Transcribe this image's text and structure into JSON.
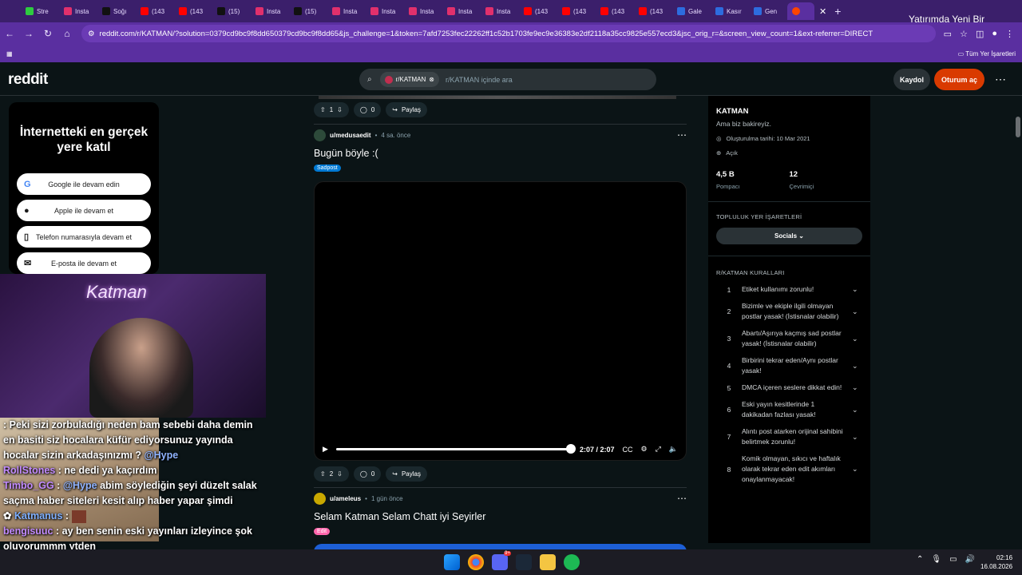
{
  "browser": {
    "tabs": [
      {
        "label": "Stre",
        "color": "#2ecc40"
      },
      {
        "label": "Insta",
        "color": "#e1306c"
      },
      {
        "label": "Soğı",
        "color": "#111111"
      },
      {
        "label": "(143",
        "color": "#ff0000"
      },
      {
        "label": "(143",
        "color": "#ff0000"
      },
      {
        "label": "(15)",
        "color": "#111111"
      },
      {
        "label": "Insta",
        "color": "#e1306c"
      },
      {
        "label": "(15)",
        "color": "#111111"
      },
      {
        "label": "Insta",
        "color": "#e1306c"
      },
      {
        "label": "Insta",
        "color": "#e1306c"
      },
      {
        "label": "Insta",
        "color": "#e1306c"
      },
      {
        "label": "Insta",
        "color": "#e1306c"
      },
      {
        "label": "Insta",
        "color": "#e1306c"
      },
      {
        "label": "(143",
        "color": "#ff0000"
      },
      {
        "label": "(143",
        "color": "#ff0000"
      },
      {
        "label": "(143",
        "color": "#ff0000"
      },
      {
        "label": "(143",
        "color": "#ff0000"
      },
      {
        "label": "Gale",
        "color": "#2d6cdf"
      },
      {
        "label": "Kasır",
        "color": "#2d6cdf"
      },
      {
        "label": "Gen",
        "color": "#2d6cdf"
      }
    ],
    "active_tab_icon": "reddit-icon",
    "url": "reddit.com/r/KATMAN/?solution=0379cd9bc9f8dd650379cd9bc9f8dd65&js_challenge=1&token=7afd7253fec22262ff1c52b1703fe9ec9e36383e2df2118a35cc9825e557ecd3&jsc_orig_r=&screen_view_count=1&ext-referrer=DIRECT",
    "bookmarks_label": "Tüm Yer İşaretleri",
    "popup_text": "Yatırımda Yeni Bir Alternatif"
  },
  "header": {
    "logo": "reddit",
    "search_chip": "r/KATMAN",
    "search_placeholder": "r/KATMAN içinde ara",
    "signup_label": "Kaydol",
    "login_label": "Oturum aç"
  },
  "signin_card": {
    "title": "İnternetteki en gerçek yere katıl",
    "options": [
      "Google ile devam edin",
      "Apple ile devam et",
      "Telefon numarasıyla devam et",
      "E-posta ile devam et"
    ]
  },
  "stream": {
    "neon_text": "Katman",
    "chat": [
      {
        "user": "",
        "text": ": Peki sizi zorbuladığı neden bam sebebi daha demin en basiti siz hocalara küfür ediyorsunuz yayında hocalar sizin arkadaşınızmı ?",
        "mention": "@Hype"
      },
      {
        "user": "RollStones",
        "text": ": ne dedi ya kaçırdım",
        "mention": ""
      },
      {
        "user": "Timbo_GG",
        "text": ":",
        "mention": "@Hype",
        "text2": "abim söylediğin şeyi düzelt salak saçma haber siteleri kesit alıp haber yapar şimdi"
      },
      {
        "user": "Katmanus",
        "text": ":",
        "mention": ""
      },
      {
        "user": "bengisuuc",
        "text": ": ay ben senin eski yayınları izleyince şok oluyorummm ytden",
        "mention": ""
      }
    ]
  },
  "feed": {
    "prev_post": {
      "votes": "1",
      "comments": "0",
      "share": "Paylaş"
    },
    "post1": {
      "author": "u/medusaedit",
      "time": "4 sa. önce",
      "title": "Bugün böyle :(",
      "flair": "Sadpost",
      "flair_color": "#0079d3",
      "video_time": "2:07 / 2:07",
      "progress": 1.0,
      "votes": "2",
      "comments": "0",
      "share": "Paylaş"
    },
    "post2": {
      "author": "u/ameleus",
      "time": "1 gün önce",
      "title": "Selam Katman Selam Chatt iyi Seyirler",
      "flair": "Edit",
      "flair_color": "#ff66ac"
    }
  },
  "sidebar": {
    "name": "KATMAN",
    "description": "Ama biz bakireyiz.",
    "created": "Oluşturulma tarihi: 10 Mar 2021",
    "visibility": "Açık",
    "members": "4,5 B",
    "members_label": "Pompacı",
    "online": "12",
    "online_label": "Çevrimiçi",
    "bookmarks_heading": "TOPLULUK YER İŞARETLERİ",
    "socials_label": "Socials",
    "rules_heading": "R/KATMAN KURALLARI",
    "rules": [
      {
        "n": "1",
        "text": "Etiket kullanımı zorunlu!"
      },
      {
        "n": "2",
        "text": "Bizimle ve ekiple ilgili olmayan postlar yasak! (İstisnalar olabilir)"
      },
      {
        "n": "3",
        "text": "Abartı/Aşırıya kaçmış sad postlar yasak! (İstisnalar olabilir)"
      },
      {
        "n": "4",
        "text": "Birbirini tekrar eden/Aynı postlar yasak!"
      },
      {
        "n": "5",
        "text": "DMCA içeren seslere dikkat edin!"
      },
      {
        "n": "6",
        "text": "Eski yayın kesitlerinde 1 dakikadan fazlası yasak!"
      },
      {
        "n": "7",
        "text": "Alıntı post atarken orijinal sahibini belirtmek zorunlu!"
      },
      {
        "n": "8",
        "text": "Komik olmayan, sıkıcı ve haftalık olarak tekrar eden edit akımları onaylanmayacak!"
      }
    ]
  },
  "taskbar": {
    "time": "02:16",
    "date": "16.08.2026",
    "discord_badge": "9+"
  }
}
